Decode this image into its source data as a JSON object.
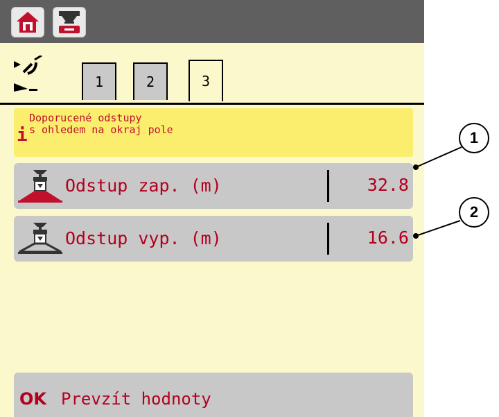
{
  "tabs": [
    {
      "label": "1",
      "active": false
    },
    {
      "label": "2",
      "active": false
    },
    {
      "label": "3",
      "active": true
    }
  ],
  "info": {
    "icon": "i",
    "text": "Doporucené odstupy\ns ohledem na okraj pole"
  },
  "rows": [
    {
      "label": "Odstup zap. (m)",
      "value": "32.8",
      "icon": "spreader-icon"
    },
    {
      "label": "Odstup vyp. (m)",
      "value": "16.6",
      "icon": "spreader-icon"
    }
  ],
  "ok": {
    "glyph": "OK",
    "label": "Prevzít hodnoty"
  },
  "callouts": [
    "1",
    "2"
  ],
  "colors": {
    "screen_bg": "#fbf8cc",
    "topbar": "#5f5f5f",
    "info_bg": "#fbee6e",
    "row_bg": "#c8c8c8",
    "accent_red": "#b3001f"
  }
}
